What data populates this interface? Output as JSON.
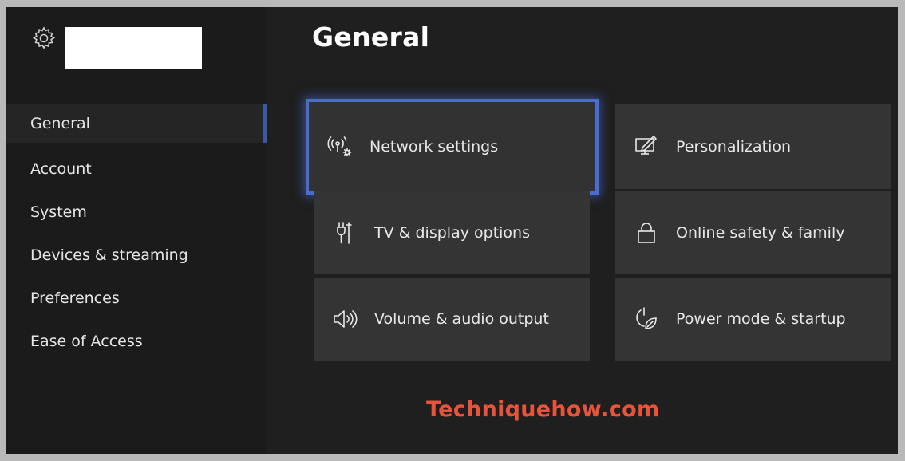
{
  "sidebar": {
    "items": [
      {
        "label": "General",
        "active": true
      },
      {
        "label": "Account"
      },
      {
        "label": "System"
      },
      {
        "label": "Devices & streaming"
      },
      {
        "label": "Preferences"
      },
      {
        "label": "Ease of Access"
      }
    ]
  },
  "main": {
    "title": "General",
    "tiles": [
      {
        "label": "Network settings",
        "icon": "network-settings-icon",
        "focused": true
      },
      {
        "label": "Personalization",
        "icon": "personalization-icon"
      },
      {
        "label": "TV & display options",
        "icon": "tv-display-icon"
      },
      {
        "label": "Online safety & family",
        "icon": "lock-icon"
      },
      {
        "label": "Volume & audio output",
        "icon": "speaker-icon"
      },
      {
        "label": "Power mode & startup",
        "icon": "power-leaf-icon"
      }
    ]
  },
  "watermark": {
    "text": "Techniquehow.com"
  },
  "colors": {
    "focus": "#4a6cd0",
    "tile": "#343434",
    "accent": "#e8533a"
  }
}
